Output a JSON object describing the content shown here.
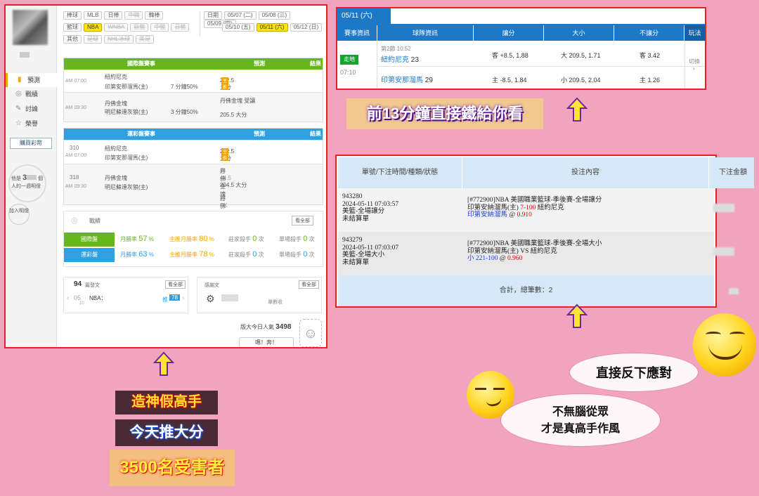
{
  "left": {
    "sidebar": {
      "items": [
        {
          "label": "預測",
          "icon": "chart-icon"
        },
        {
          "label": "戰績",
          "icon": "trophy-icon"
        },
        {
          "label": "討論",
          "icon": "chat-icon"
        },
        {
          "label": "榮譽",
          "icon": "medal-icon"
        }
      ],
      "buy_button": "購買彩幣",
      "circle_text_1": "他是",
      "circle_num": "3",
      "circle_text_2": "個",
      "circle_text_3": "人的一週明燈",
      "join_text": "加入明燈"
    },
    "filters": {
      "row1": [
        "棒球",
        "MLB",
        "日棒",
        "中職",
        "韓棒"
      ],
      "row2": [
        "籃球",
        "NBA",
        "WNBA",
        "歐籃",
        "中籃",
        "日籃"
      ],
      "row3": [
        "其他",
        "足球",
        "NHL冰球",
        "美足"
      ],
      "date_label": "日期",
      "dates_row1": [
        "05/07 (二)",
        "05/08 (三)",
        "05/09 (四)"
      ],
      "dates_row2": [
        "05/10 (五)",
        "05/11 (六)",
        "05/12 (日)"
      ]
    },
    "intl_table": {
      "h1": "國際盤賽事",
      "h2": "預測",
      "h3": "結果",
      "rows": [
        {
          "time": "AM 07:00",
          "team1": "紐約尼克",
          "team2": "印第安那溜馬(主)",
          "pct": "7 分鐘50%",
          "pred1": "222.5 大分",
          "tag": "主推"
        },
        {
          "time": "AM 09:30",
          "team1": "丹佛金塊",
          "team2": "明尼蘇達灰狼(主)",
          "pct": "3 分鐘50%",
          "pred1": "丹佛金塊 受讓",
          "pred2": "205.5 大分"
        }
      ]
    },
    "lottery_table": {
      "h1": "運彩盤賽事",
      "h2": "預測",
      "h3": "結果",
      "rows": [
        {
          "num": "310",
          "time": "AM 07:00",
          "team1": "紐約尼克",
          "team2": "印第安那溜馬(主)",
          "pred1": "222.5 大分",
          "tag": "主推"
        },
        {
          "num": "318",
          "time": "AM 09:30",
          "team1": "丹佛金塊",
          "team2": "明尼蘇達灰狼(主)",
          "pred1": "丹佛金塊",
          "pred1b": "客 +4.5",
          "pred2": "204.5 大分",
          "pred3": "丹佛金塊",
          "pred3b": "客 PK"
        }
      ]
    },
    "stats": {
      "title": "戰績",
      "view_all": "看全部",
      "intl": {
        "label": "國際盤",
        "month_rate": "月勝率",
        "v1": "57",
        "main_rate": "主推月勝率",
        "v2": "80",
        "streak": "莊家殺手",
        "v3": "0",
        "streak_unit": "次",
        "single": "單場殺手",
        "v4": "0",
        "single_unit": "次"
      },
      "lottery": {
        "label": "運彩盤",
        "month_rate": "月勝率",
        "v1": "63",
        "main_rate": "主推月勝率",
        "v2": "78",
        "streak": "莊家殺手",
        "v3": "0",
        "streak_unit": "次",
        "single": "單場殺手",
        "v4": "0",
        "single_unit": "次"
      },
      "percent": "%"
    },
    "cards": {
      "c1_num": "94",
      "c1_title": "篇發文",
      "c1_btn": "看全部",
      "c1_date": "05",
      "c1_sub": "10",
      "c1_league": "NBA：",
      "c1_push": "推",
      "c1_push_num": "78",
      "c2_title": "感謝文",
      "c2_btn": "看全部",
      "c2_text": "單數收"
    },
    "popularity_label": "版大今日人氣",
    "popularity": "3498",
    "bottom_btn": "嗯！奔！"
  },
  "righttop": {
    "date": "05/11 (六)",
    "headers": [
      "賽事資訊",
      "球隊資訊",
      "讓分",
      "大小",
      "不讓分",
      "玩法"
    ],
    "status": "走地",
    "time": "07:10",
    "quarter": "第2節 10:52",
    "team1": "紐約尼克",
    "score1": "23",
    "team2": "印第安那溜馬",
    "score2": "29",
    "spread1": "客 +8.5, 1.88",
    "spread2": "主 -8.5, 1.84",
    "ou1": "大 209.5, 1.71",
    "ou2": "小 209.5, 2.04",
    "ml1": "客 3.42",
    "ml2": "主 1.26",
    "switch": "切換"
  },
  "rightbot": {
    "headers": [
      "單號/下注時間/種類/狀態",
      "投注內容",
      "下注金額"
    ],
    "rows": [
      {
        "id": "943280",
        "time": "2024-05-11 07:03:57",
        "type": "美籃-全場讓分",
        "status": "未結算單",
        "line1": "[#772900]NBA 美國職業籃球-季後賽-全場讓分",
        "line2a": "印第安納溜馬(主)",
        "line2b": "7-100",
        "line2c": "紐約尼克",
        "line3a": "印第安納溜馬",
        "line3b": "@",
        "line3c": "0.910"
      },
      {
        "id": "943279",
        "time": "2024-05-11 07:03:07",
        "type": "美籃-全場大小",
        "status": "未結算單",
        "line1": "[#772900]NBA 美國職業籃球-季後賽-全場大小",
        "line2a": "印第安納溜馬(主) VS 紐約尼克",
        "line3a": "小 221-100",
        "line3b": "@",
        "line3c": "0.960"
      }
    ],
    "total": "合計，總筆數：2"
  },
  "captions": {
    "c1": "前13分鐘直接鐵給你看",
    "c2": "造神假高手",
    "c3": "今天推大分",
    "c4": "3500名受害者",
    "bubble1": "直接反下應對",
    "bubble2a": "不無腦從眾",
    "bubble2b": "才是真高手作風"
  }
}
